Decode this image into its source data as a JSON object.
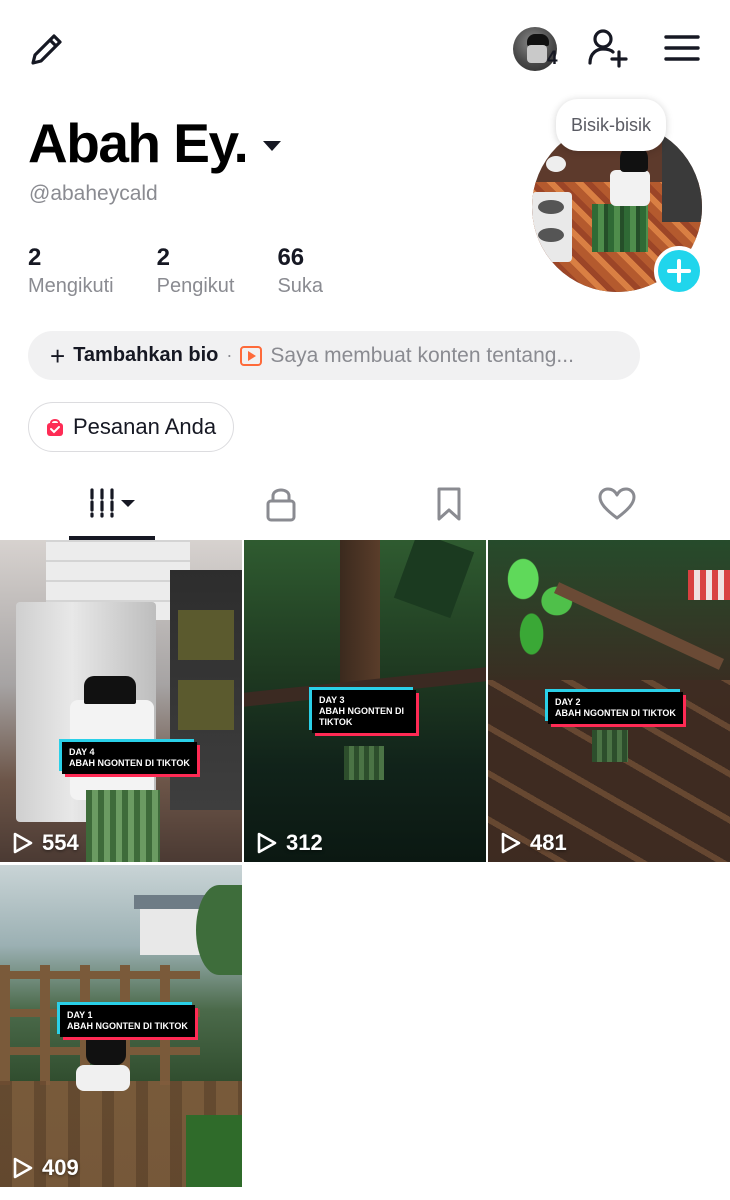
{
  "header": {
    "friend_count": "4",
    "icons": {
      "edit": "pencil-icon",
      "add_friend": "person-plus-icon",
      "menu": "hamburger-menu-icon"
    }
  },
  "profile": {
    "display_name": "Abah Ey.",
    "username": "@abaheycald",
    "bubble": "Bisik-bisik",
    "stats": [
      {
        "value": "2",
        "label": "Mengikuti"
      },
      {
        "value": "2",
        "label": "Pengikut"
      },
      {
        "value": "66",
        "label": "Suka"
      }
    ],
    "bio_add": "Tambahkan bio",
    "bio_dot": "·",
    "bio_prompt": "Saya membuat konten tentang...",
    "orders": "Pesanan Anda"
  },
  "tabs": [
    {
      "name": "videos",
      "icon": "grid-columns-icon",
      "active": true
    },
    {
      "name": "private",
      "icon": "lock-icon",
      "active": false
    },
    {
      "name": "saved",
      "icon": "bookmark-icon",
      "active": false
    },
    {
      "name": "liked",
      "icon": "heart-icon",
      "active": false
    }
  ],
  "videos": [
    {
      "views": "554",
      "caption_line1": "DAY 4",
      "caption_line2": "ABAH NGONTEN DI TIKTOK"
    },
    {
      "views": "312",
      "caption_line1": "DAY 3",
      "caption_line2": "ABAH NGONTEN DI",
      "caption_line3": "TIKTOK"
    },
    {
      "views": "481",
      "caption_line1": "DAY 2",
      "caption_line2": "ABAH NGONTEN DI TIKTOK"
    },
    {
      "views": "409",
      "caption_line1": "DAY 1",
      "caption_line2": "ABAH NGONTEN DI TIKTOK"
    }
  ],
  "colors": {
    "accent": "#20d5ec",
    "caption_cyan": "#2ad0e8",
    "caption_red": "#ff2a54",
    "orders_pink": "#fe2c55"
  }
}
